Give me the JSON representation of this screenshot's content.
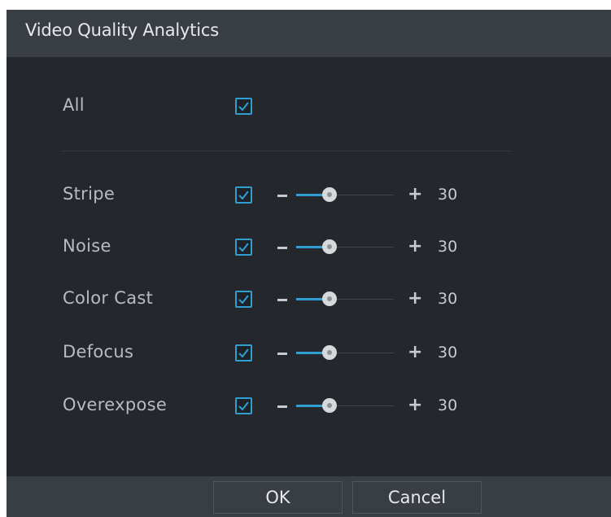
{
  "dialog": {
    "title": "Video Quality Analytics"
  },
  "all": {
    "label": "All",
    "checked": true
  },
  "items": [
    {
      "label": "Stripe",
      "checked": true,
      "value": "30"
    },
    {
      "label": "Noise",
      "checked": true,
      "value": "30"
    },
    {
      "label": "Color Cast",
      "checked": true,
      "value": "30"
    },
    {
      "label": "Defocus",
      "checked": true,
      "value": "30"
    },
    {
      "label": "Overexpose",
      "checked": true,
      "value": "30"
    }
  ],
  "slider": {
    "min_symbol": "−",
    "max_symbol": "+",
    "level_fraction": 0.3
  },
  "footer": {
    "ok_label": "OK",
    "cancel_label": "Cancel"
  },
  "colors": {
    "accent": "#2f9fd2",
    "dialog_bg": "#24282d",
    "titlebar_bg": "#393e45"
  }
}
